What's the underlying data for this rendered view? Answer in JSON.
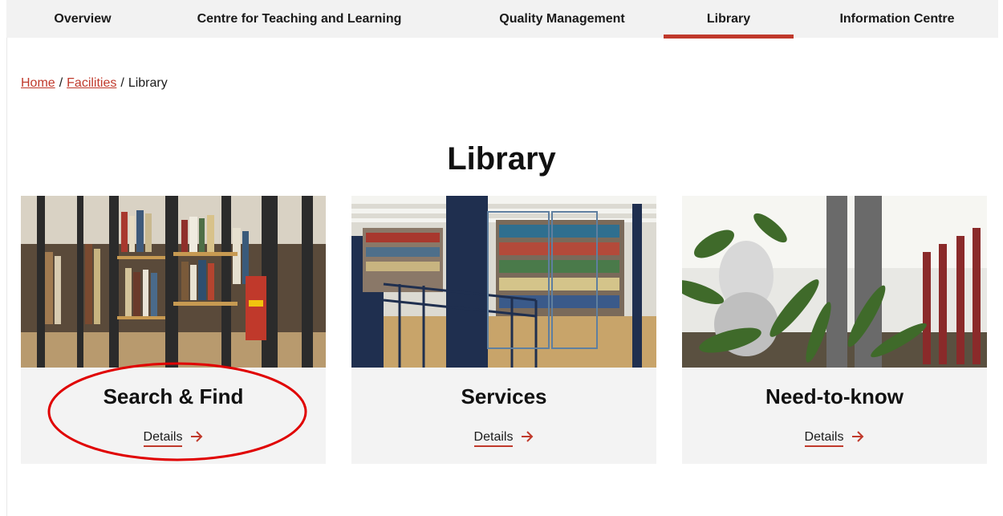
{
  "nav": {
    "items": [
      {
        "label": "Overview"
      },
      {
        "label": "Centre for Teaching and Learning"
      },
      {
        "label": "Quality Management"
      },
      {
        "label": "Library",
        "active": true
      },
      {
        "label": "Information Centre"
      }
    ]
  },
  "breadcrumb": {
    "home": "Home",
    "separator": "/",
    "facilities": "Facilities",
    "current": "Library"
  },
  "page": {
    "title": "Library"
  },
  "cards": [
    {
      "title": "Search & Find",
      "link_label": "Details",
      "image": "bookshelves-photo"
    },
    {
      "title": "Services",
      "link_label": "Details",
      "image": "library-hall-photo"
    },
    {
      "title": "Need-to-know",
      "link_label": "Details",
      "image": "reading-area-plant-photo"
    }
  ],
  "colors": {
    "accent": "#c0392b",
    "annotation": "#e00000",
    "card_bg": "#f3f3f3",
    "nav_bg": "#f2f2f2"
  },
  "annotation": {
    "shape": "ellipse",
    "target": "Search & Find card"
  }
}
